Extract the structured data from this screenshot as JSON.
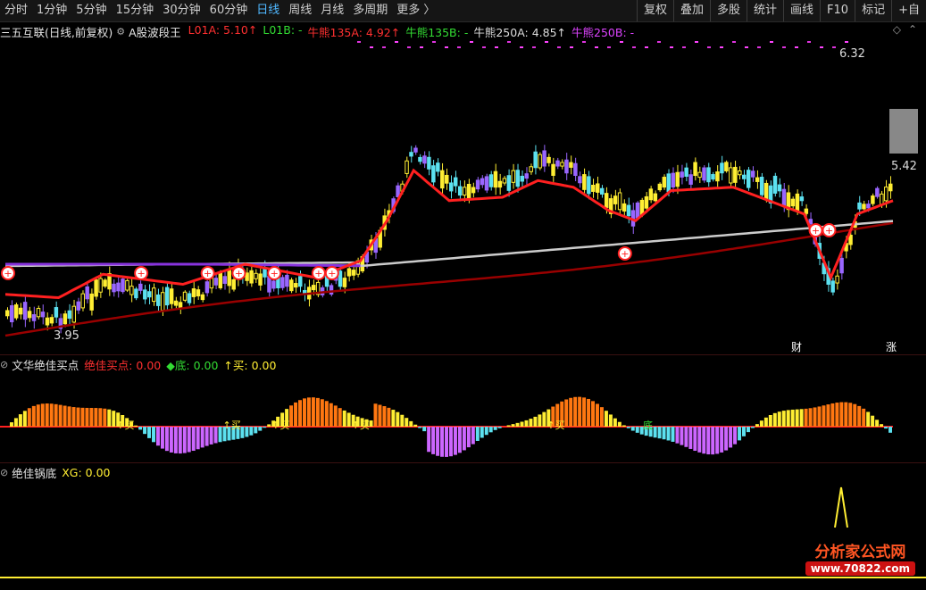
{
  "toolbar": {
    "periods": [
      "分时",
      "1分钟",
      "5分钟",
      "15分钟",
      "30分钟",
      "60分钟",
      "日线",
      "周线",
      "月线",
      "多周期",
      "更多 〉"
    ],
    "active_index": 6,
    "actions": [
      "复权",
      "叠加",
      "多股",
      "统计",
      "画线",
      "F10",
      "标记",
      "+自"
    ]
  },
  "main_panel": {
    "stock_name": "三五互联(日线,前复权)",
    "indicator_name": "A股波段王",
    "lines": [
      {
        "label": "L01A:",
        "value": "5.10",
        "arrow": "↑",
        "color": "#ff3030"
      },
      {
        "label": "L01B:",
        "value": "-",
        "arrow": "",
        "color": "#33dd33"
      },
      {
        "label": "牛熊135A:",
        "value": "4.92",
        "arrow": "↑",
        "color": "#ff3030"
      },
      {
        "label": "牛熊135B:",
        "value": "-",
        "arrow": "",
        "color": "#33dd33"
      },
      {
        "label": "牛熊250A:",
        "value": "4.85",
        "arrow": "↑",
        "color": "#dddddd"
      },
      {
        "label": "牛熊250B:",
        "value": "-",
        "arrow": "",
        "color": "#dd44ff"
      }
    ],
    "price_high": "6.32",
    "price_low": "3.95",
    "price_last": "5.42",
    "tag_left": "财",
    "tag_right": "涨"
  },
  "panel2": {
    "name": "文华绝佳买点",
    "lines": [
      {
        "label": "绝佳买点:",
        "value": "0.00",
        "color": "#ff3030"
      },
      {
        "label": "◆底:",
        "value": "0.00",
        "color": "#33dd33"
      },
      {
        "label": "↑买:",
        "value": "0.00",
        "color": "#ffee33"
      }
    ],
    "buy_label": "↑买",
    "bottom_label": "底"
  },
  "panel3": {
    "name": "绝佳锅底",
    "lines": [
      {
        "label": "XG:",
        "value": "0.00",
        "color": "#ffee33"
      }
    ]
  },
  "watermark": {
    "text": "分析家公式网",
    "url": "www.70822.com"
  },
  "colors": {
    "up": "#ffee33",
    "up_strong": "#ff3030",
    "down": "#5ce1f0",
    "down_strong": "#9966ff",
    "ma_short": "#ff2020",
    "ma_mid": "#990000",
    "ma_long": "#cccccc",
    "ma_purple": "#8833dd"
  }
}
